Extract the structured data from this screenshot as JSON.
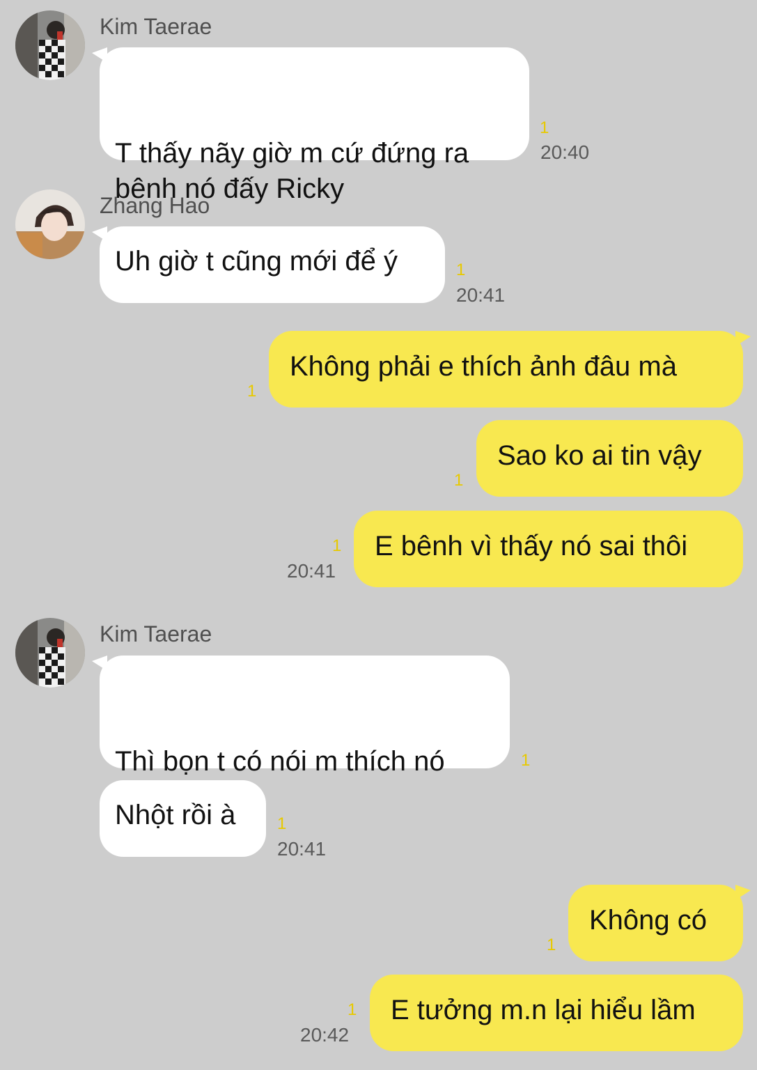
{
  "colors": {
    "background": "#cdcdcd",
    "incoming_bubble": "#ffffff",
    "outgoing_bubble": "#f8e850",
    "unread_count": "#e7c900",
    "timestamp": "#595959"
  },
  "messages": [
    {
      "sender": "Kim Taerae",
      "text": "T thấy nãy giờ m cứ đứng ra\nbênh nó đấy Ricky",
      "unread": "1",
      "time": "20:40"
    },
    {
      "sender": "Zhang Hao",
      "text": "Uh giờ t cũng mới để ý",
      "unread": "1",
      "time": "20:41"
    },
    {
      "text": "Không phải e thích ảnh đâu mà",
      "unread": "1"
    },
    {
      "text": "Sao ko ai tin vậy",
      "unread": "1"
    },
    {
      "text": "E bênh vì thấy nó sai thôi",
      "unread": "1",
      "time": "20:41"
    },
    {
      "sender": "Kim Taerae",
      "text": "Thì bọn t có nói m thích nó\nnữa đâu:))",
      "unread": "1"
    },
    {
      "text": "Nhột rồi à",
      "unread": "1",
      "time": "20:41"
    },
    {
      "text": "Không có",
      "unread": "1"
    },
    {
      "text": "E tưởng m.n lại hiểu lầm",
      "unread": "1",
      "time": "20:42"
    }
  ]
}
